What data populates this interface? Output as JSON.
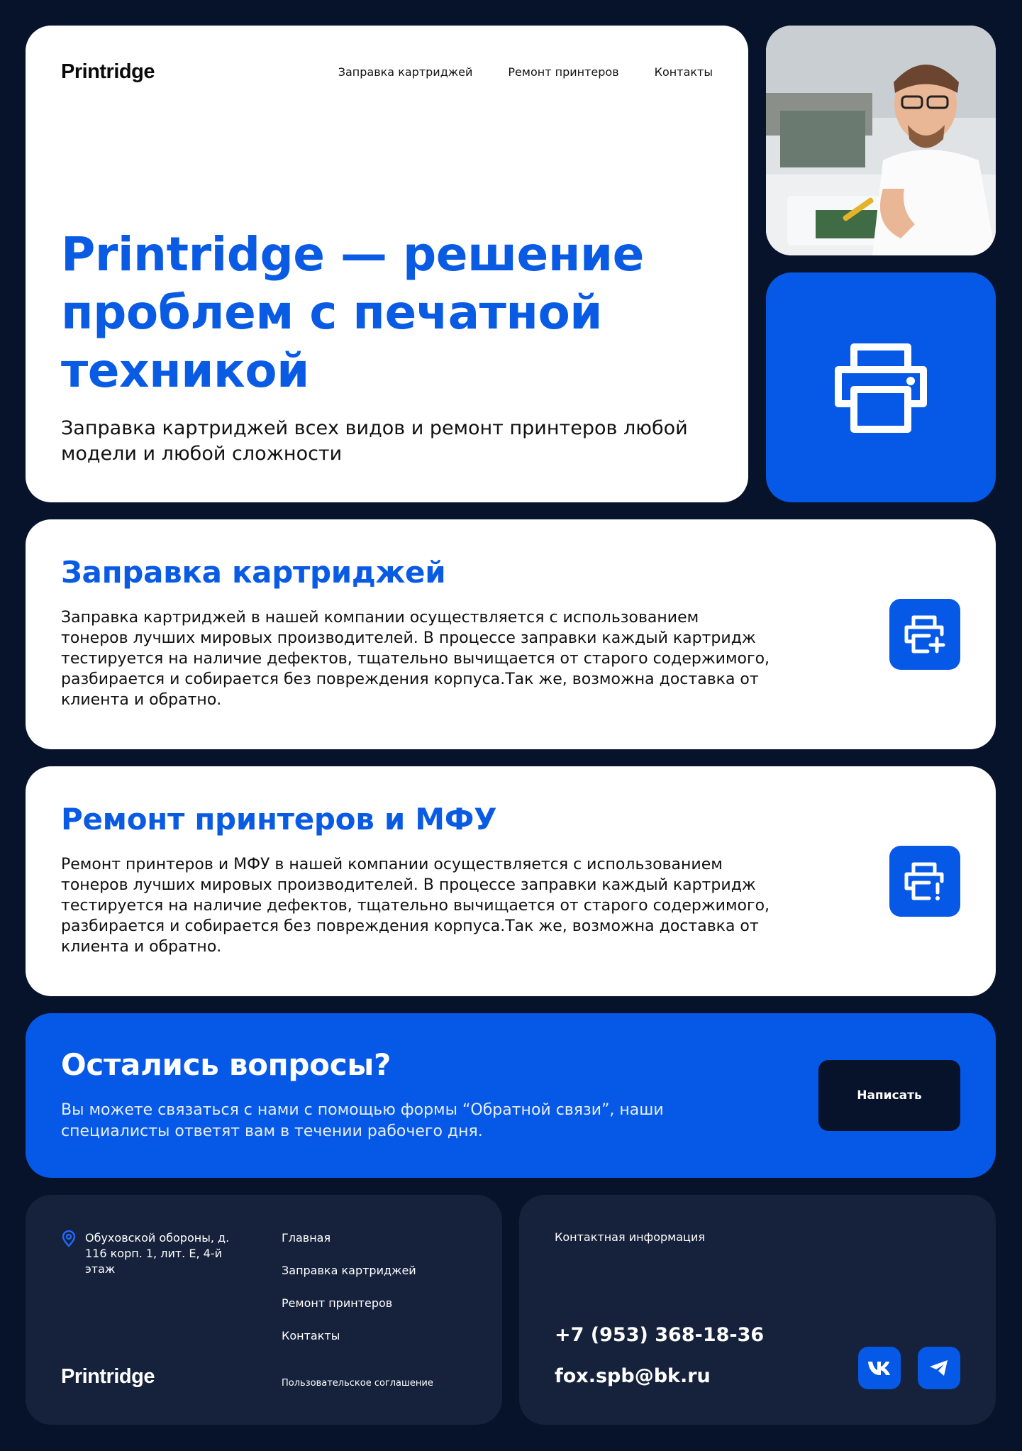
{
  "brand": "Printridge",
  "nav": [
    "Заправка картриджей",
    "Ремонт принтеров",
    "Контакты"
  ],
  "hero": {
    "title": "Printridge — решение проблем с печатной техникой",
    "subtitle": "Заправка картриджей всех видов и ремонт принтеров любой модели и любой сложности"
  },
  "services": [
    {
      "title": "Заправка картриджей",
      "text": "Заправка картриджей в нашей компании осуществляется с использованием тонеров лучших мировых производителей. В процессе заправки каждый картридж тестируется на наличие дефектов, тщательно вычищается от старого содержимого, разбирается и собирается без повреждения корпуса.Так же, возможна доставка от клиента и обратно.",
      "icon": "printer-plus-icon"
    },
    {
      "title": "Ремонт принтеров и МФУ",
      "text": "Ремонт принтеров и МФУ в нашей компании осуществляется с использованием тонеров лучших мировых производителей. В процессе заправки каждый картридж тестируется на наличие дефектов, тщательно вычищается от старого содержимого, разбирается и собирается без повреждения корпуса.Так же, возможна доставка от клиента и обратно.",
      "icon": "printer-alert-icon"
    }
  ],
  "cta": {
    "title": "Остались вопросы?",
    "text": "Вы можете связаться с нами с помощью формы “Обратной связи”, наши специалисты ответят вам в течении рабочего дня.",
    "button": "Написать"
  },
  "footer": {
    "address": "Обуховской обороны, д. 116 корп. 1, лит. Е, 4-й этаж",
    "links": [
      "Главная",
      "Заправка картриджей",
      "Ремонт принтеров",
      "Контакты"
    ],
    "agreement": "Пользовательское соглашение",
    "contact_heading": "Контактная информация",
    "phone": "+7 (953) 368-18-36",
    "email": "fox.spb@bk.ru",
    "social": [
      "vk-icon",
      "telegram-icon"
    ]
  },
  "colors": {
    "background": "#07132a",
    "accent": "#0658e6",
    "card": "#ffffff",
    "footer_card": "#16223b"
  }
}
